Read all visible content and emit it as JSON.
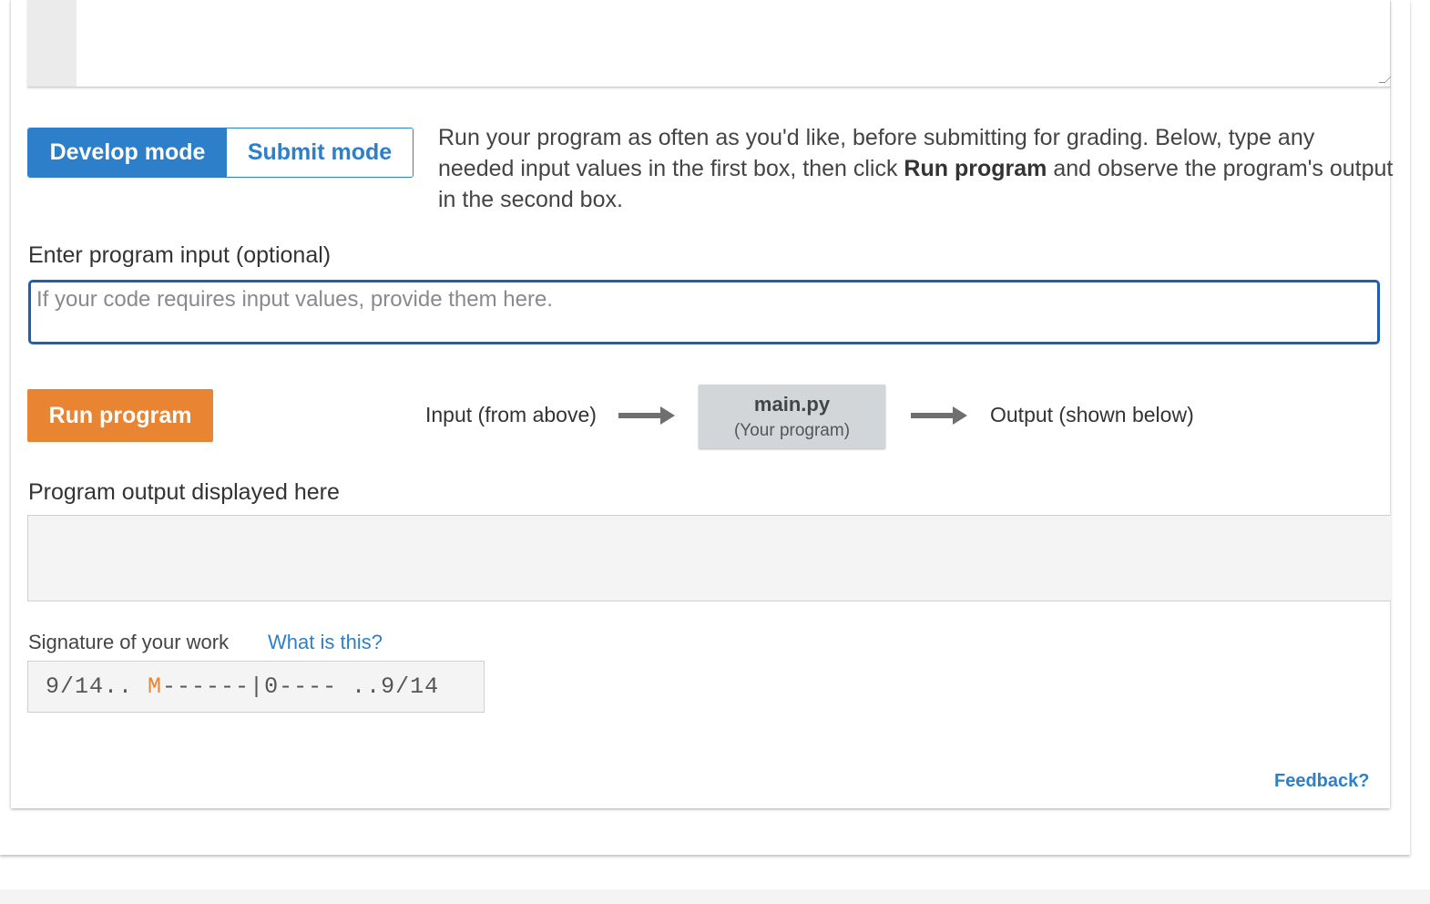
{
  "modes": {
    "develop_label": "Develop mode",
    "submit_label": "Submit mode"
  },
  "instructions": {
    "part1": "Run your program as often as you'd like, before submitting for grading. Below, type any needed input values in the first box, then click ",
    "bold": "Run program",
    "part2": " and observe the program's output in the second box."
  },
  "input": {
    "label": "Enter program input (optional)",
    "placeholder": "If your code requires input values, provide them here.",
    "value": ""
  },
  "run": {
    "button_label": "Run program"
  },
  "flow": {
    "input_text": "Input (from above)",
    "program_name": "main.py",
    "program_sub": "(Your program)",
    "output_text": "Output (shown below)"
  },
  "output": {
    "label": "Program output displayed here",
    "content": ""
  },
  "signature": {
    "label": "Signature of your work",
    "link": "What is this?",
    "prefix": "9/14.. ",
    "marker": "M",
    "suffix": "------|0---- ..9/14"
  },
  "feedback": {
    "link": "Feedback?"
  },
  "colors": {
    "accent_blue": "#2d7fc9",
    "run_orange": "#e98433",
    "input_border": "#1d5fb8"
  }
}
